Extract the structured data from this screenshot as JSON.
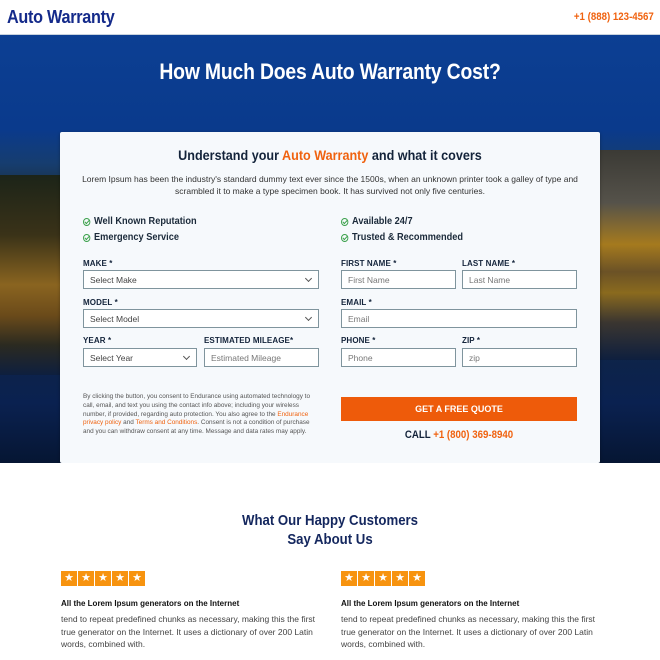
{
  "header": {
    "brand": "Auto Warranty",
    "phone": "+1 (888) 123-4567"
  },
  "hero": {
    "title": "How Much Does Auto Warranty Cost?"
  },
  "form_card": {
    "title_before": "Understand your ",
    "title_accent": "Auto Warranty",
    "title_after": " and what it covers",
    "description": "Lorem Ipsum has been the industry's standard dummy text ever since the 1500s, when an unknown printer took a galley of type and scrambled it to make a type specimen book. It has survived not only five centuries.",
    "features": [
      "Well Known Reputation",
      "Emergency Service",
      "Available 24/7",
      "Trusted & Recommended"
    ],
    "fields": {
      "make": {
        "label": "MAKE *",
        "value": "Select Make"
      },
      "model": {
        "label": "MODEL *",
        "value": "Select Model"
      },
      "year": {
        "label": "YEAR *",
        "value": "Select Year"
      },
      "mileage": {
        "label": "ESTIMATED MILEAGE*",
        "placeholder": "Estimated Mileage"
      },
      "first_name": {
        "label": "FIRST NAME *",
        "placeholder": "First Name"
      },
      "last_name": {
        "label": "LAST NAME *",
        "placeholder": "Last Name"
      },
      "email": {
        "label": "EMAIL *",
        "placeholder": "Email"
      },
      "phone": {
        "label": "PHONE *",
        "placeholder": "Phone"
      },
      "zip": {
        "label": "ZIP *",
        "placeholder": "zip"
      }
    },
    "consent": {
      "text_1": "By clicking the button, you consent to Endurance using automated technology to call, email, and text you using the contact info above; including your wireless number, if provided, regarding auto protection. You also agree to the ",
      "privacy_link": "Endurance privacy policy",
      "text_2": " and ",
      "terms_link": "Terms and Conditions",
      "text_3": ". Consent is not a condition of purchase and you can withdraw consent at any time. Message and data rates may apply."
    },
    "cta_label": "GET A FREE QUOTE",
    "call_prefix": "CALL ",
    "call_number": "+1 (800) 369-8940"
  },
  "testimonials": {
    "title_line1": "What Our Happy Customers",
    "title_line2": "Say About Us",
    "items": [
      {
        "rating": 5,
        "heading": "All the Lorem Ipsum generators on the Internet",
        "body": "tend to repeat predefined chunks as necessary, making this the first true generator on the Internet. It uses a dictionary of over 200 Latin words, combined with."
      },
      {
        "rating": 5,
        "heading": "All the Lorem Ipsum generators on the Internet",
        "body": "tend to repeat predefined chunks as necessary, making this the first true generator on the Internet. It uses a dictionary of over 200 Latin words, combined with."
      }
    ]
  },
  "colors": {
    "brand_navy": "#142a8a",
    "accent_orange": "#f0620f",
    "star_orange": "#f7930f",
    "check_green": "#3aa04a"
  }
}
